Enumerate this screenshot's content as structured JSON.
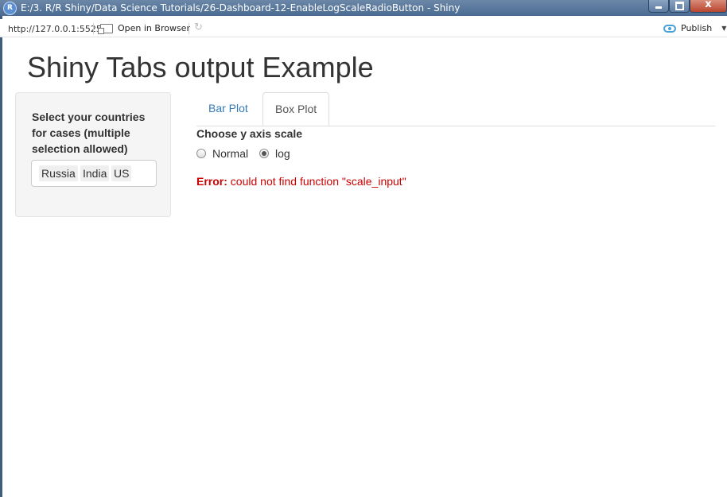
{
  "window": {
    "title": "E:/3. R/R Shiny/Data Science Tutorials/26-Dashboard-12-EnableLogScaleRadioButton - Shiny",
    "close_glyph": "x"
  },
  "toolbar": {
    "url": "http://127.0.0.1:5525",
    "open_in_browser": "Open in Browser",
    "publish": "Publish"
  },
  "page": {
    "title": "Shiny Tabs output Example"
  },
  "sidebar": {
    "label": "Select your countries for cases (multiple selection allowed)",
    "selected": [
      "Russia",
      "India",
      "US"
    ]
  },
  "tabs": [
    {
      "label": "Bar Plot",
      "active": false
    },
    {
      "label": "Box Plot",
      "active": true
    }
  ],
  "scale": {
    "label": "Choose y axis scale",
    "options": [
      {
        "label": "Normal",
        "checked": false
      },
      {
        "label": "log",
        "checked": true
      }
    ]
  },
  "error": {
    "prefix": "Error:",
    "message": "could not find function \"scale_input\""
  },
  "icons": {
    "app": "r-app-icon",
    "open": "open-in-browser-icon",
    "refresh": "refresh-icon",
    "publish": "publish-icon"
  }
}
